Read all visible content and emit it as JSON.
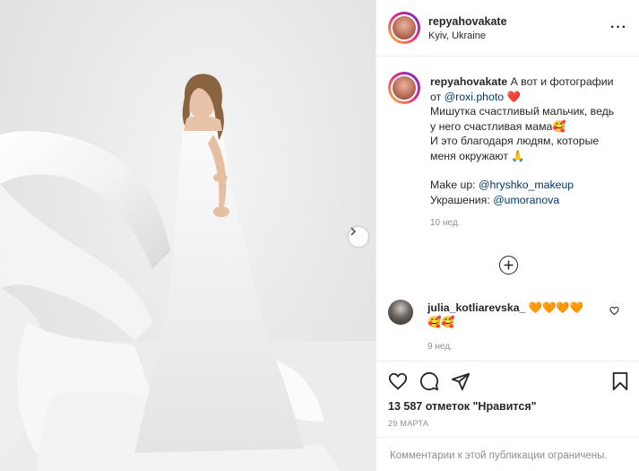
{
  "post": {
    "username": "repyahovakate",
    "location": "Kyiv, Ukraine",
    "more_icon": "ellipsis-icon",
    "next_icon": "chevron-right-icon"
  },
  "caption": {
    "username": "repyahovakate",
    "line1": "А вот и фотографии",
    "line2_prefix": "от ",
    "mention_photographer": "@roxi.photo",
    "heart_emoji": "❤️",
    "para2_line1": "Мишутка счастливый мальчик, ведь",
    "para2_line2": "у него счастливая мама🥰",
    "para2_line3": "И это благодаря людям, которые",
    "para2_line4": "меня окружают 🙏",
    "makeup_label": "Make up: ",
    "makeup_mention": "@hryshko_makeup",
    "jewelry_label": "Украшения: ",
    "jewelry_mention": "@umoranova",
    "time": "10 нед."
  },
  "load_more_icon": "plus-circle-icon",
  "comments": [
    {
      "username": "julia_kotliarevska_",
      "text_line1": "🧡🧡🧡🧡",
      "text_line2": "🥰🥰",
      "time": "9 нед."
    }
  ],
  "actions": {
    "icons": [
      "heart-icon",
      "comment-icon",
      "share-icon",
      "bookmark-icon"
    ],
    "likes": "13 587 отметок \"Нравится\"",
    "date": "29 МАРТА",
    "comments_limited": "Комментарии к этой публикации ограничены."
  }
}
